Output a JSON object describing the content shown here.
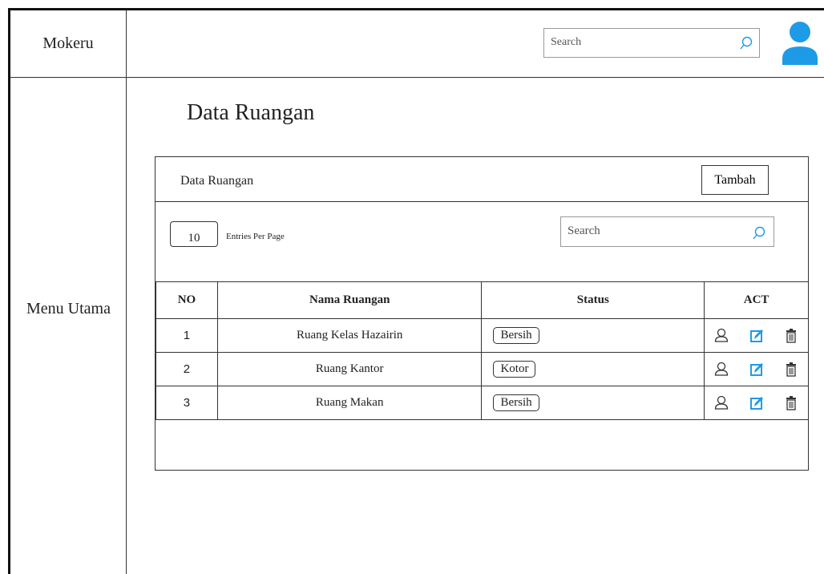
{
  "brand": "Mokeru",
  "header": {
    "search_placeholder": "Search"
  },
  "sidebar": {
    "menu_label": "Menu Utama"
  },
  "page": {
    "title": "Data Ruangan"
  },
  "card": {
    "title": "Data Ruangan",
    "add_label": "Tambah",
    "entries_value": "10",
    "entries_label": "Entries Per Page",
    "search_placeholder": "Search"
  },
  "table": {
    "columns": [
      "NO",
      "Nama Ruangan",
      "Status",
      "ACT"
    ],
    "rows": [
      {
        "no": "1",
        "name": "Ruang Kelas Hazairin",
        "status": "Bersih"
      },
      {
        "no": "2",
        "name": "Ruang Kantor",
        "status": "Kotor"
      },
      {
        "no": "3",
        "name": "Ruang Makan",
        "status": "Bersih"
      }
    ]
  },
  "icons": {
    "search": "search-icon",
    "avatar": "user-avatar-icon",
    "row_actions": [
      "user-icon",
      "edit-icon",
      "trash-icon"
    ]
  },
  "colors": {
    "accent": "#1e9be6",
    "border": "#333333"
  }
}
